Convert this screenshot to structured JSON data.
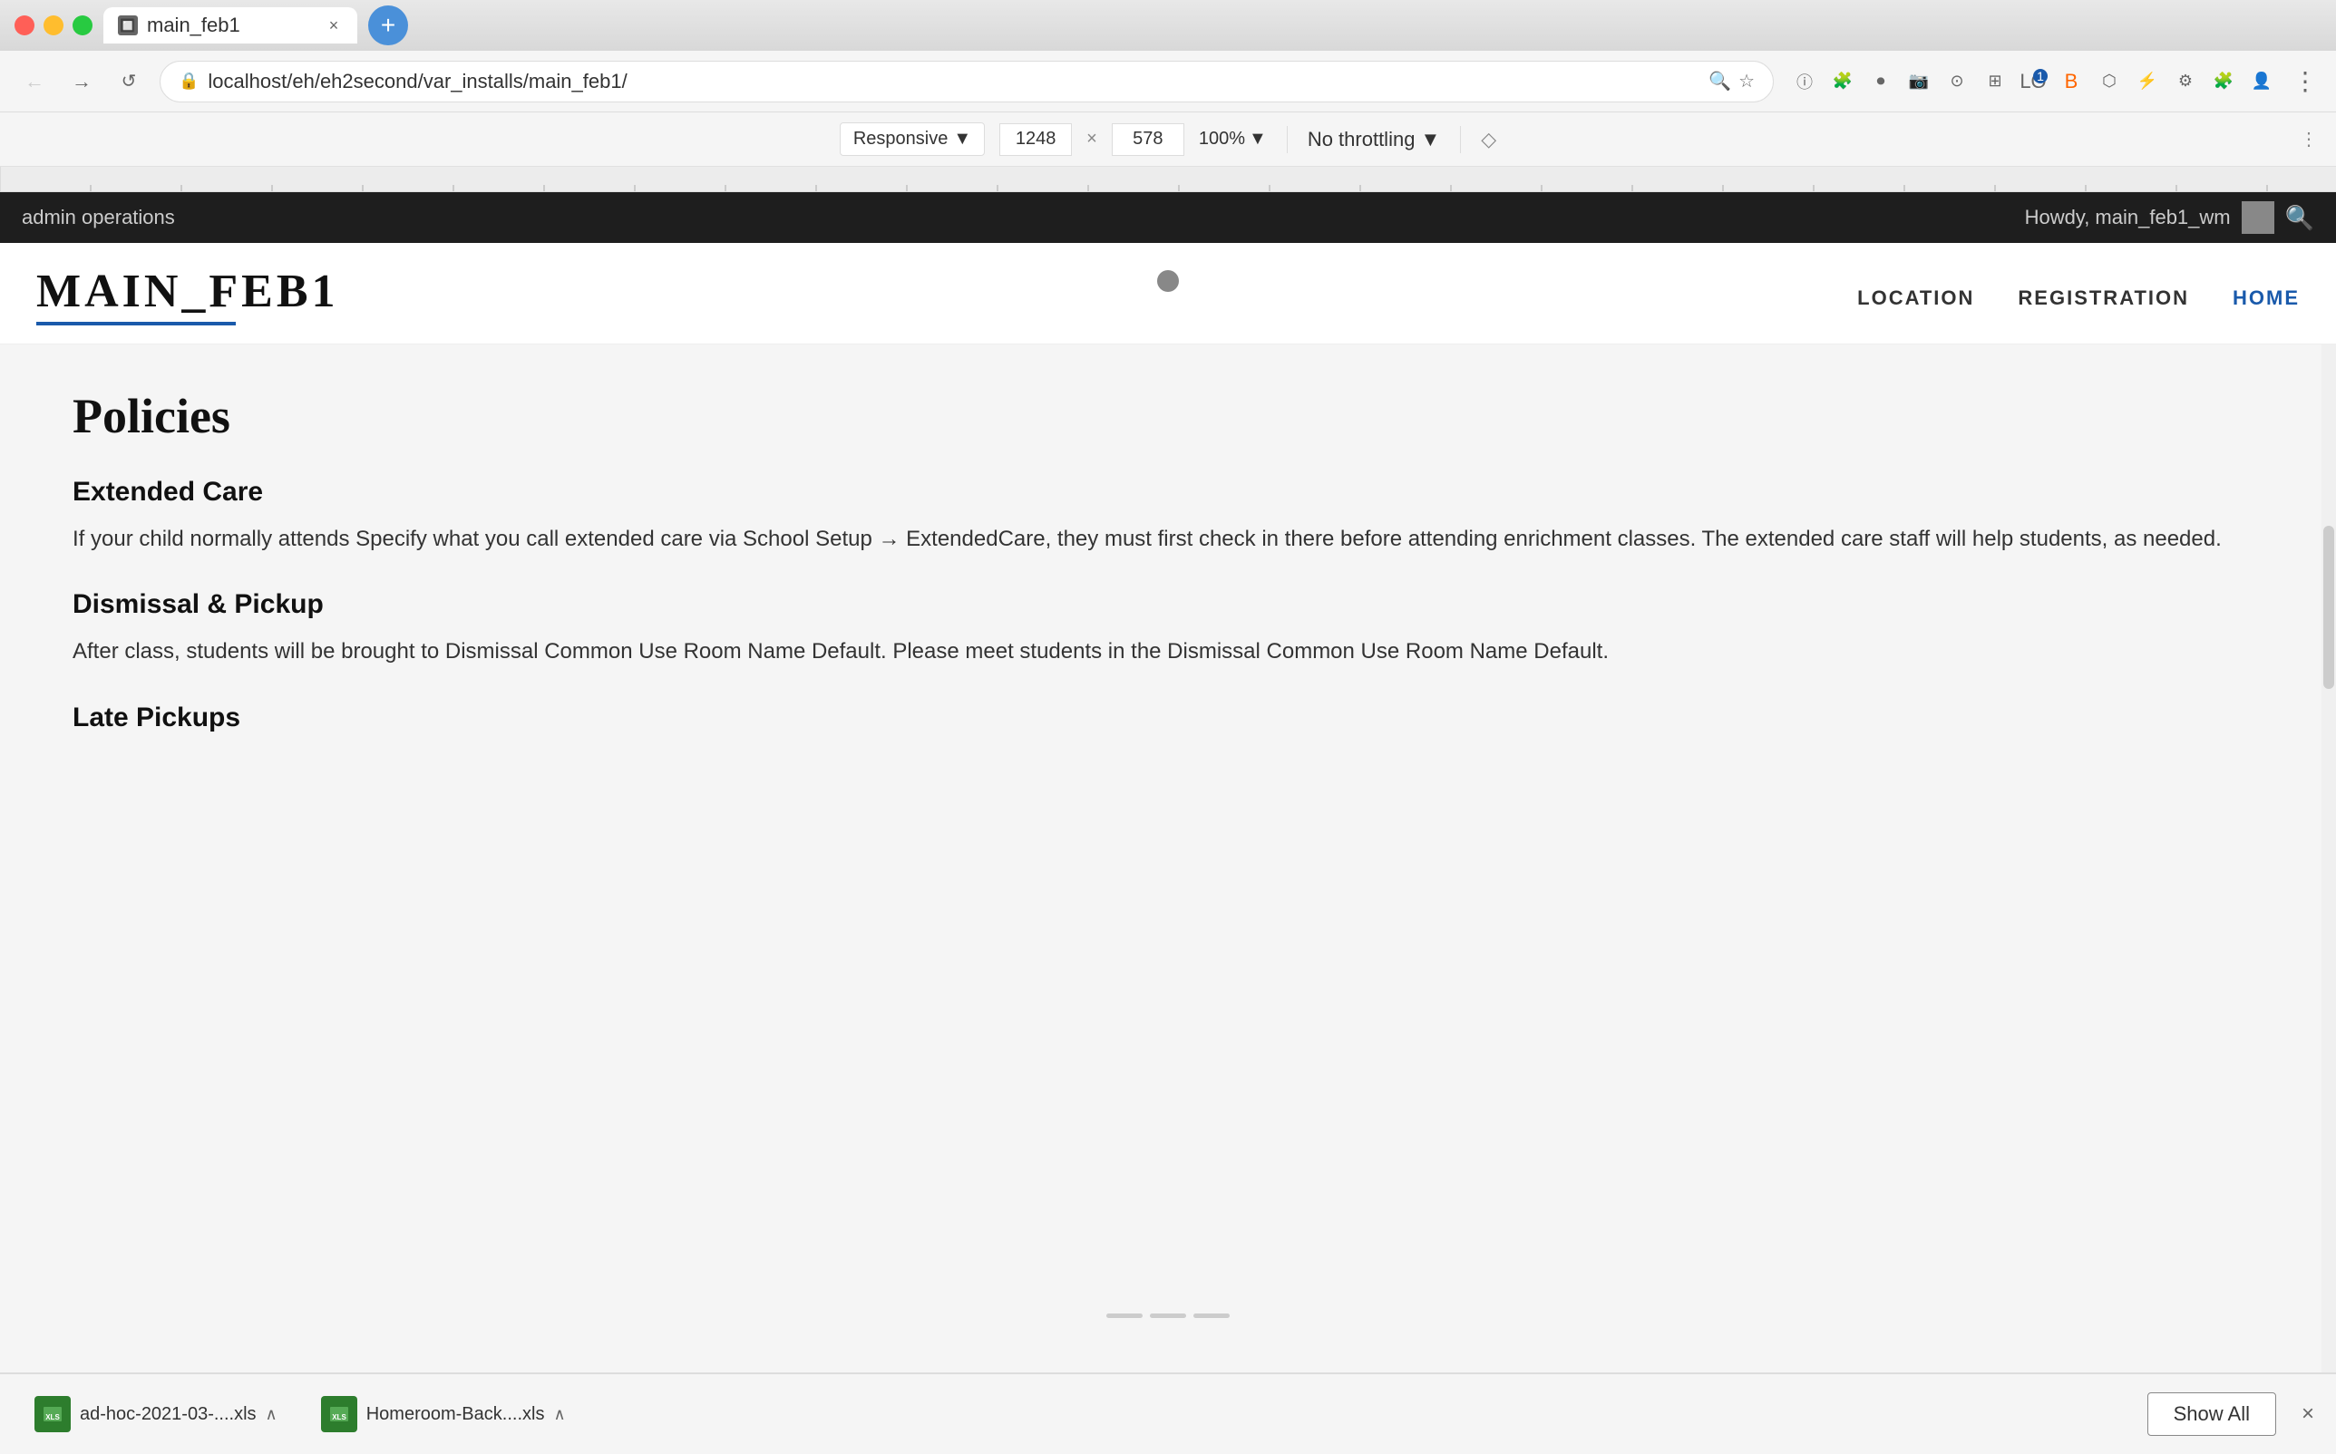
{
  "browser": {
    "tab_title": "main_feb1",
    "tab_close_icon": "×",
    "new_tab_icon": "+",
    "url": "localhost/eh/eh2second/var_installs/main_feb1/",
    "back_icon": "←",
    "forward_icon": "→",
    "refresh_icon": "↺",
    "menu_icon": "⋮"
  },
  "devtools": {
    "responsive_label": "Responsive",
    "width": "1248",
    "height": "578",
    "zoom_label": "100%",
    "throttle_label": "No throttling",
    "screenshot_icon": "◇",
    "more_icon": "⋮"
  },
  "admin_bar": {
    "label": "admin operations",
    "user_greeting": "Howdy, main_feb1_wm",
    "search_icon": "🔍"
  },
  "site": {
    "logo": "MAIN_FEB1",
    "nav": [
      {
        "label": "LOCATION",
        "active": false
      },
      {
        "label": "REGISTRATION",
        "active": false
      },
      {
        "label": "HOME",
        "active": true
      }
    ]
  },
  "content": {
    "page_title": "Policies",
    "sections": [
      {
        "title": "Extended Care",
        "text": "If your child normally attends Specify what you call extended care via School Setup → ExtendedCare, they must first check in there before attending enrichment classes. The extended care staff will help students, as needed."
      },
      {
        "title": "Dismissal & Pickup",
        "text": "After class, students will be brought to Dismissal Common Use Room Name Default. Please meet students in the Dismissal Common Use Room Name Default."
      },
      {
        "title": "Late Pickups",
        "text": ""
      }
    ]
  },
  "downloads": [
    {
      "name": "ad-hoc-2021-03-....xls",
      "icon_color": "#2d7d2d"
    },
    {
      "name": "Homeroom-Back....xls",
      "icon_color": "#2d7d2d"
    }
  ],
  "downloads_bar": {
    "show_all_label": "Show All",
    "close_icon": "×"
  }
}
